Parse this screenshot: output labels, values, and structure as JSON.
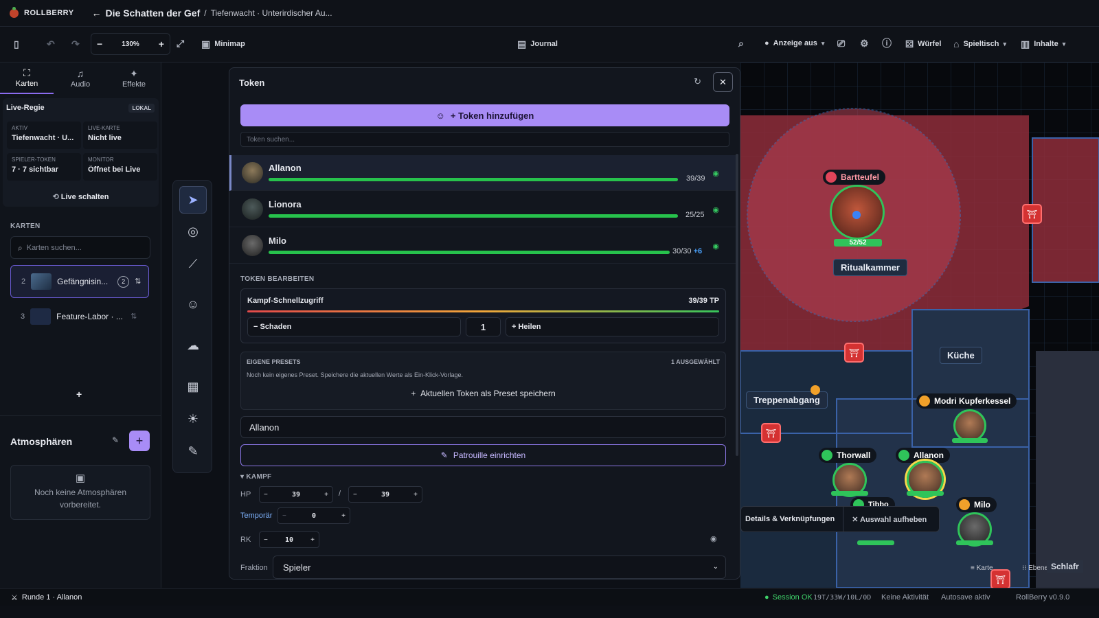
{
  "app": {
    "brand": "ROLLBERRY",
    "title": "Die Schatten der Gef",
    "subtitle": "Tiefenwacht · Unterirdischer Au..."
  },
  "toolbar": {
    "zoom": "130%",
    "minimap": "Minimap",
    "journal": "Journal",
    "display": "Anzeige aus",
    "dice": "Würfel",
    "table": "Spieltisch",
    "content": "Inhalte"
  },
  "sidebar": {
    "tabs": [
      {
        "label": "Karten"
      },
      {
        "label": "Audio"
      },
      {
        "label": "Effekte"
      }
    ],
    "live": {
      "title": "Live-Regie",
      "badge": "LOKAL",
      "cells": [
        {
          "label": "AKTIV",
          "value": "Tiefenwacht · U..."
        },
        {
          "label": "LIVE-KARTE",
          "value": "Nicht live"
        },
        {
          "label": "SPIELER-TOKEN",
          "value": "7 · 7 sichtbar"
        },
        {
          "label": "MONITOR",
          "value": "Öffnet bei Live"
        }
      ],
      "button": "Live schalten"
    },
    "maps_heading": "KARTEN",
    "maps_search_placeholder": "Karten suchen...",
    "maps": [
      {
        "index": "2",
        "name": "Gefängnisin...",
        "count": "2"
      },
      {
        "index": "3",
        "name": "Feature-Labor · ..."
      }
    ],
    "atmo_heading": "Atmosphären",
    "atmo_empty": "Noch keine Atmosphären vorbereitet."
  },
  "panel": {
    "title": "Token",
    "add_button": "+ Token hinzufügen",
    "search_placeholder": "Token suchen...",
    "tokens": [
      {
        "name": "Allanon",
        "hp": "39/39",
        "fill": 1.0
      },
      {
        "name": "Lionora",
        "hp": "25/25",
        "fill": 1.0
      },
      {
        "name": "Milo",
        "hp": "30/30",
        "bonus": "+6",
        "fill": 1.0
      }
    ],
    "edit_heading": "TOKEN BEARBEITEN",
    "quick": {
      "title": "Kampf-Schnellzugriff",
      "hp": "39/39 TP",
      "damage": "− Schaden",
      "amount": "1",
      "heal": "+ Heilen"
    },
    "presets": {
      "heading": "EIGENE PRESETS",
      "selected": "1 AUSGEWÄHLT",
      "note": "Noch kein eigenes Preset. Speichere die aktuellen Werte als Ein-Klick-Vorlage.",
      "save": "Aktuellen Token als Preset speichern"
    },
    "name_value": "Allanon",
    "patrol": "Patrouille einrichten",
    "combat_heading": "KAMPF",
    "hp_label": "HP",
    "hp_current": "39",
    "hp_max": "39",
    "temp_label": "Temporär",
    "temp_value": "0",
    "ac_label": "RK",
    "ac_value": "10",
    "faction_label": "Fraktion",
    "faction_value": "Spieler"
  },
  "map": {
    "labels": {
      "ritual": "Ritualkammer",
      "kitchen": "Küche",
      "stairs": "Treppenabgang"
    },
    "tokens": {
      "bartteufel": "Bartteufel",
      "bartteufel_hp": "52/52",
      "modri": "Modri Kupferkessel",
      "thorwall": "Thorwall",
      "allanon": "Allanon",
      "milo": "Milo",
      "tibbo": "Tibbo"
    },
    "ctx": {
      "details": "Details & Verknüpfungen",
      "deselect": "Auswahl aufheben"
    },
    "corner": {
      "map": "Karte",
      "layers": "Ebenen",
      "extra": "Schlafr"
    }
  },
  "status": {
    "round": "Runde 1 · Allanon",
    "session": "Session OK",
    "stats": "19T/33W/10L/0D",
    "activity": "Keine Aktivität",
    "autosave": "Autosave aktiv",
    "version": "RollBerry v0.9.0"
  },
  "colors": {
    "accent": "#a88cf6",
    "hp": "#27c24c",
    "danger": "#d43232"
  }
}
